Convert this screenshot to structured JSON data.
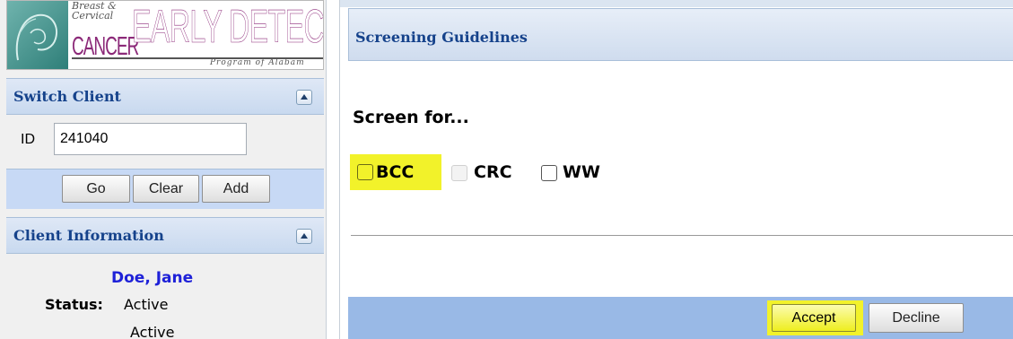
{
  "logo": {
    "line1": "Breast &",
    "line2": "Cervical",
    "cancer": "CANCER",
    "main": "EARLY DETECTION",
    "program": "Program of Alabam"
  },
  "switch_client": {
    "title": "Switch Client",
    "id_label": "ID",
    "id_value": "241040",
    "buttons": {
      "go": "Go",
      "clear": "Clear",
      "add": "Add"
    }
  },
  "client_info": {
    "title": "Client Information",
    "name": "Doe, Jane",
    "status_label": "Status:",
    "status_value": "Active",
    "status_value_2": "Active"
  },
  "screening": {
    "title": "Screening Guidelines",
    "prompt": "Screen for...",
    "options": [
      {
        "label": "BCC",
        "checked": false,
        "enabled": true,
        "highlighted": true
      },
      {
        "label": "CRC",
        "checked": false,
        "enabled": false,
        "highlighted": false
      },
      {
        "label": "WW",
        "checked": false,
        "enabled": true,
        "highlighted": false
      }
    ],
    "accept_label": "Accept",
    "decline_label": "Decline"
  },
  "colors": {
    "header_text": "#15428b",
    "highlight": "#f2f22a",
    "client_name": "#1e21d8",
    "footer_bar": "#99b9e6",
    "logo_purple": "#8c2a79"
  },
  "icons": [
    "collapse-up-icon",
    "logo-portrait-icon"
  ]
}
